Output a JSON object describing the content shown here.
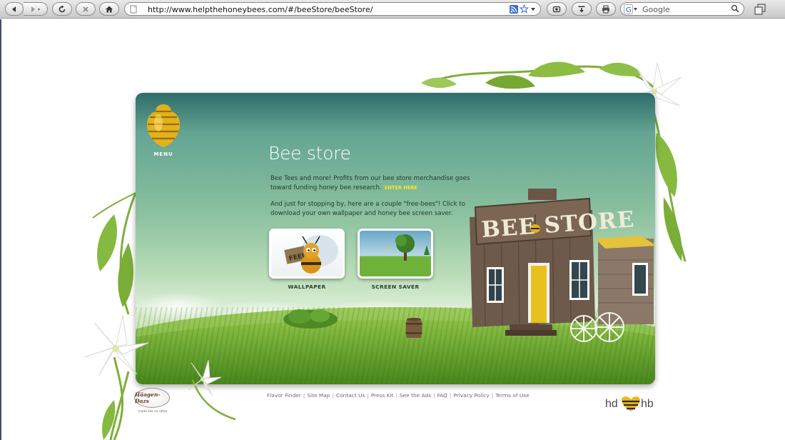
{
  "browser": {
    "url": "http://www.helpthehoneybees.com/#/beeStore/beeStore/",
    "search_placeholder": "Google",
    "icons": [
      "back-arrow-icon",
      "forward-arrow-icon",
      "reload-icon",
      "stop-icon",
      "home-icon",
      "page-icon",
      "rss-icon",
      "bookmark-star-icon",
      "screenshot-icon",
      "download-icon",
      "print-icon",
      "search-engine-icon",
      "magnifier-icon",
      "window-icon"
    ]
  },
  "nav": {
    "menu_label": "MENU"
  },
  "store": {
    "title": "Bee store",
    "paragraph1": "Bee Tees and more! Profits from our bee store merchandise goes toward funding honey bee research.",
    "enter_link": "ENTER HERE",
    "paragraph2": "And just for stopping by, here are a couple \"free-bees\"! Click to download your own wallpaper and honey bee screen saver.",
    "downloads": [
      {
        "label": "WALLPAPER"
      },
      {
        "label": "SCREEN SAVER"
      }
    ],
    "sign_text": "BEE STORE"
  },
  "footer": {
    "links": [
      "Flavor Finder",
      "Site Map",
      "Contact Us",
      "Press Kit",
      "See the Ads",
      "FAQ",
      "Privacy Policy",
      "Terms of Use"
    ],
    "brand_left": "Häagen-Dazs",
    "brand_left_tagline": "made like no other",
    "brand_right_left": "hd",
    "brand_right_right": "hb"
  },
  "colors": {
    "sky_top": "#2f6c6a",
    "sky_mid": "#88bf9e",
    "grass": "#5f9d2b",
    "link_yellow": "#f2e82a",
    "hive_gold": "#e2b21d",
    "store_wood": "#6e5a4a"
  }
}
